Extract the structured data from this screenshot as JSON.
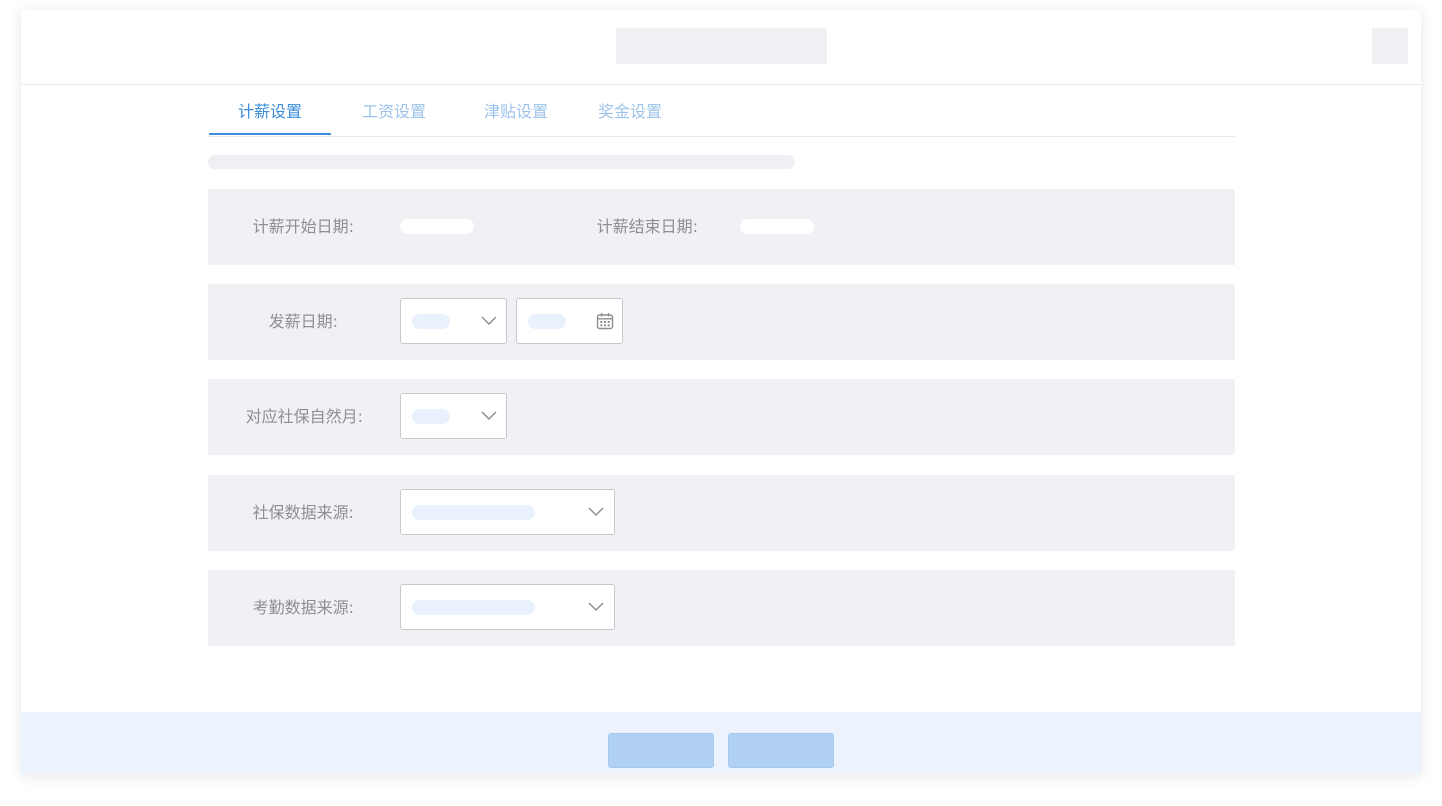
{
  "tabs": [
    {
      "label": "计薪设置",
      "active": true
    },
    {
      "label": "工资设置",
      "active": false
    },
    {
      "label": "津贴设置",
      "active": false
    },
    {
      "label": "奖金设置",
      "active": false
    }
  ],
  "form": {
    "pay_start_label": "计薪开始日期:",
    "pay_end_label": "计薪结束日期:",
    "pay_date_label": "发薪日期:",
    "social_month_label": "对应社保自然月:",
    "social_source_label": "社保数据来源:",
    "attendance_source_label": "考勤数据来源:"
  },
  "colors": {
    "accent": "#3d8fdb",
    "tab_inactive": "#9cc3ea",
    "row_bg": "#f0f1f5",
    "footer_bg": "#ecf3fc",
    "button_bg": "#b0d0f4"
  },
  "icons": {
    "dropdown": "chevron-down-icon",
    "calendar": "calendar-icon"
  }
}
